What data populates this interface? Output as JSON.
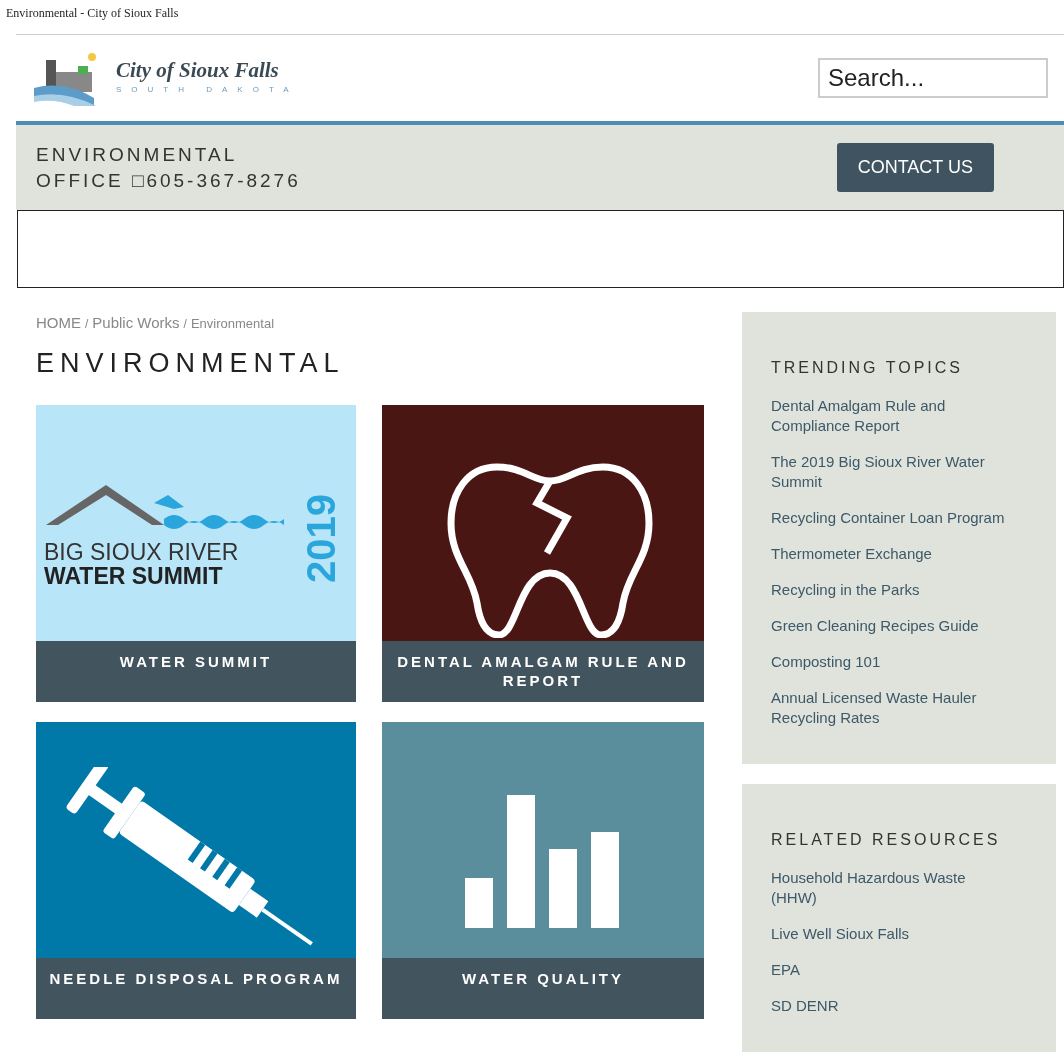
{
  "browser_title": "Environmental - City of Sioux Falls",
  "logo": {
    "name": "City of Sioux Falls",
    "subtitle": "SOUTH DAKOTA"
  },
  "search": {
    "placeholder": "Search..."
  },
  "office_bar": {
    "lines": [
      "ENVIRONMENTAL",
      "OFFICE □605-367-8276"
    ],
    "button": "CONTACT US"
  },
  "breadcrumb": [
    "HOME",
    "Public Works",
    "Environmental"
  ],
  "breadcrumb_separator": "/",
  "heading": "ENVIRONMENTAL",
  "tiles": [
    {
      "kind": "summit",
      "caption": "WATER SUMMIT",
      "art_text": [
        "BIG SIOUX RIVER",
        "WATER SUMMIT",
        "2019"
      ]
    },
    {
      "kind": "tooth",
      "caption": "DENTAL AMALGAM RULE AND REPORT"
    },
    {
      "kind": "syringe",
      "caption": "NEEDLE DISPOSAL PROGRAM"
    },
    {
      "kind": "bars",
      "caption": "WATER QUALITY"
    }
  ],
  "sidebar": [
    {
      "title": "TRENDING TOPICS",
      "links": [
        "Dental Amalgam Rule and Compliance Report",
        "The 2019 Big Sioux River Water Summit",
        "Recycling Container Loan Program",
        "Thermometer Exchange",
        "Recycling in the Parks",
        "Green Cleaning Recipes Guide",
        "Composting 101",
        "Annual Licensed Waste Hauler Recycling Rates"
      ]
    },
    {
      "title": "RELATED RESOURCES",
      "links": [
        "Household Hazardous Waste (HHW)",
        "Live Well Sioux Falls",
        "EPA",
        "SD DENR"
      ]
    }
  ]
}
